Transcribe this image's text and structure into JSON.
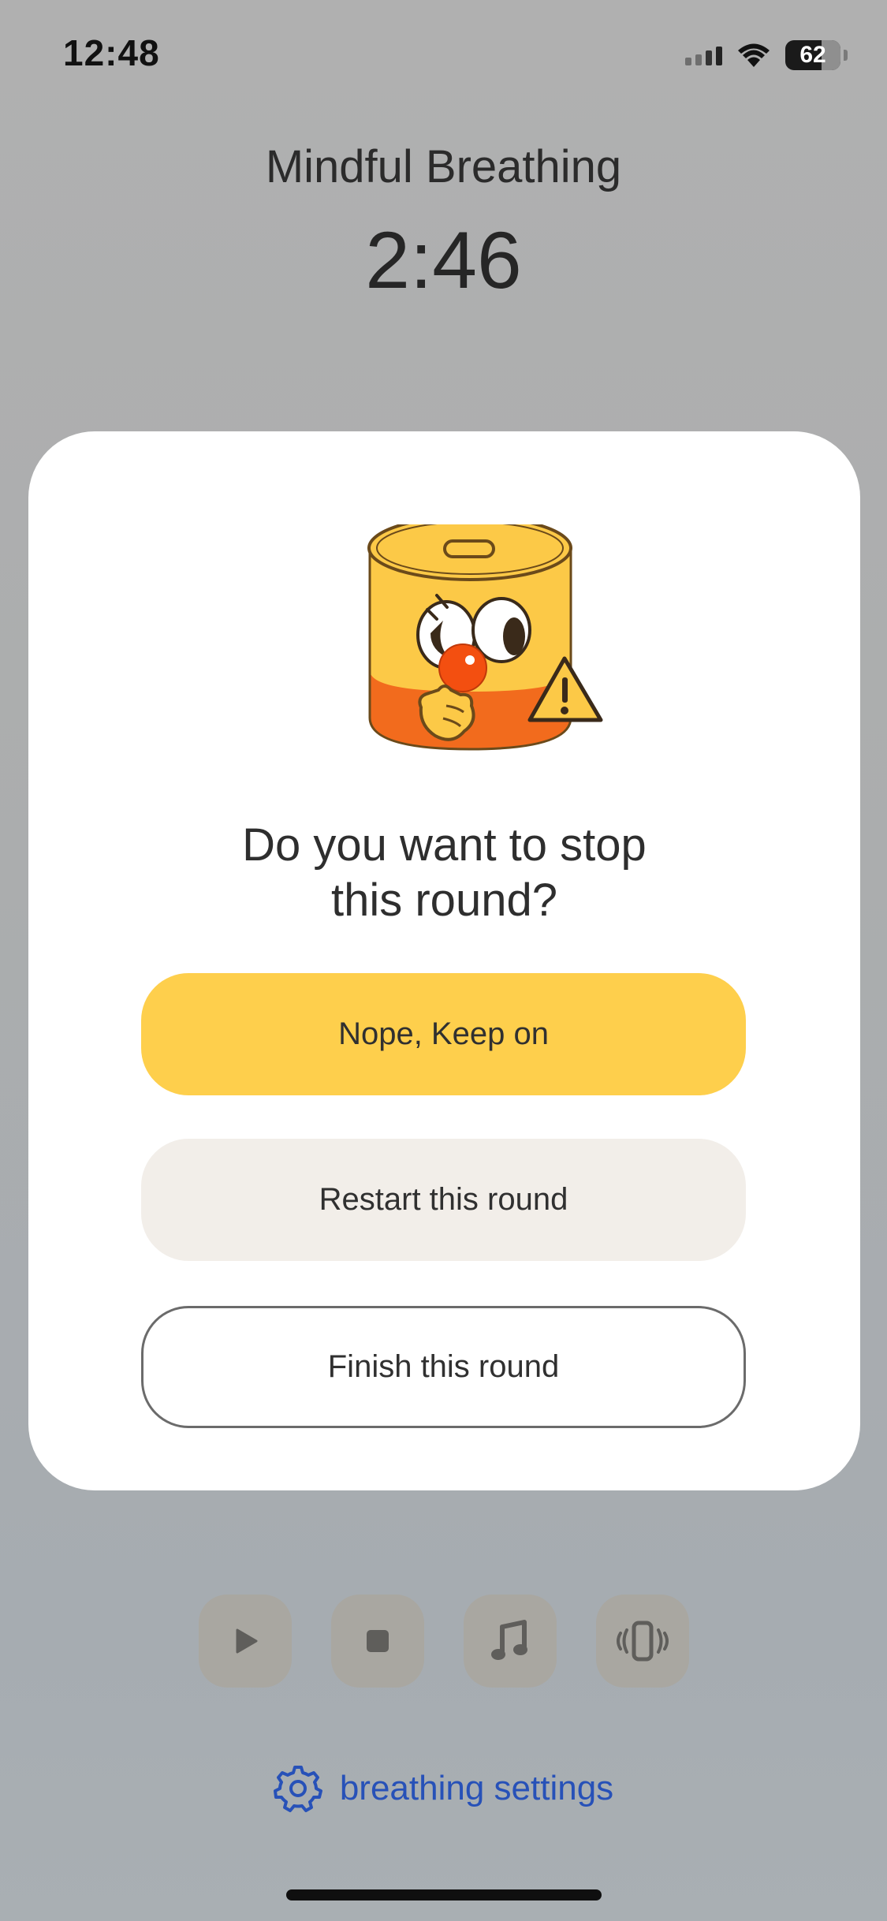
{
  "status_bar": {
    "time": "12:48",
    "battery": "62"
  },
  "session": {
    "title": "Mindful Breathing",
    "timer": "2:46"
  },
  "dialog": {
    "question_line1": "Do you want to stop",
    "question_line2": "this round?",
    "keep_label": "Nope, Keep on",
    "restart_label": "Restart this round",
    "finish_label": "Finish this round"
  },
  "controls": {
    "play_icon": "play-icon",
    "stop_icon": "stop-icon",
    "music_icon": "music-note-icon",
    "vibrate_icon": "vibrate-icon"
  },
  "footer": {
    "settings_label": "breathing settings"
  },
  "colors": {
    "accent_yellow": "#fecf4c",
    "restart_bg": "#f2eee9",
    "link_blue": "#2751b8"
  }
}
